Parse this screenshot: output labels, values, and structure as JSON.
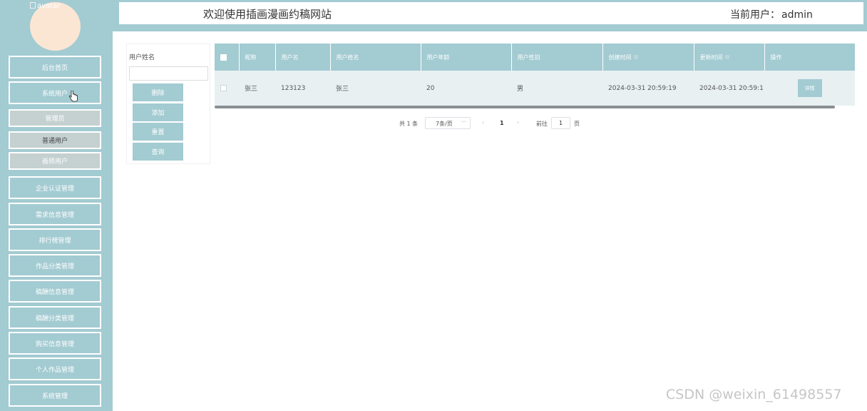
{
  "sidebar": {
    "avatar_alt": "avatar",
    "menu": [
      {
        "label": "后台首页"
      },
      {
        "label": "系统用户"
      },
      {
        "label": "企业认证管理"
      },
      {
        "label": "需求信息管理"
      },
      {
        "label": "排行榜管理"
      },
      {
        "label": "作品分类管理"
      },
      {
        "label": "稿酬信息管理"
      },
      {
        "label": "稿酬分类管理"
      },
      {
        "label": "购买信息管理"
      },
      {
        "label": "个人作品管理"
      },
      {
        "label": "系统管理"
      }
    ],
    "submenu": [
      {
        "label": "管理员"
      },
      {
        "label": "普通用户",
        "selected": true
      },
      {
        "label": "画师用户"
      }
    ]
  },
  "header": {
    "title": "欢迎使用插画漫画约稿网站",
    "user_label": "当前用户：",
    "user_name": "admin"
  },
  "search": {
    "label": "用户姓名",
    "value": "",
    "buttons": {
      "delete": "删除",
      "add": "添加",
      "reset": "重置",
      "query": "查询"
    }
  },
  "table": {
    "columns": {
      "nickname": "昵称",
      "username": "用户名",
      "realname": "用户姓名",
      "age": "用户年龄",
      "gender": "用户性别",
      "created": "创建时间",
      "updated": "更新时间",
      "actions": "操作"
    },
    "rows": [
      {
        "nickname": "张三",
        "username": "123123",
        "realname": "张三",
        "age": "20",
        "gender": "男",
        "created": "2024-03-31 20:59:19",
        "updated": "2024-03-31 20:59:1",
        "action_label": "详情"
      }
    ]
  },
  "pagination": {
    "total": "共 1 条",
    "page_size": "7条/页",
    "current_page": "1",
    "goto_label": "前往",
    "goto_value": "1",
    "page_suffix": "页"
  },
  "watermark": "CSDN @weixin_61498557",
  "colors": {
    "accent": "#a3cbd2",
    "row_bg": "#e8f0f2",
    "avatar": "#fbe6d4"
  }
}
